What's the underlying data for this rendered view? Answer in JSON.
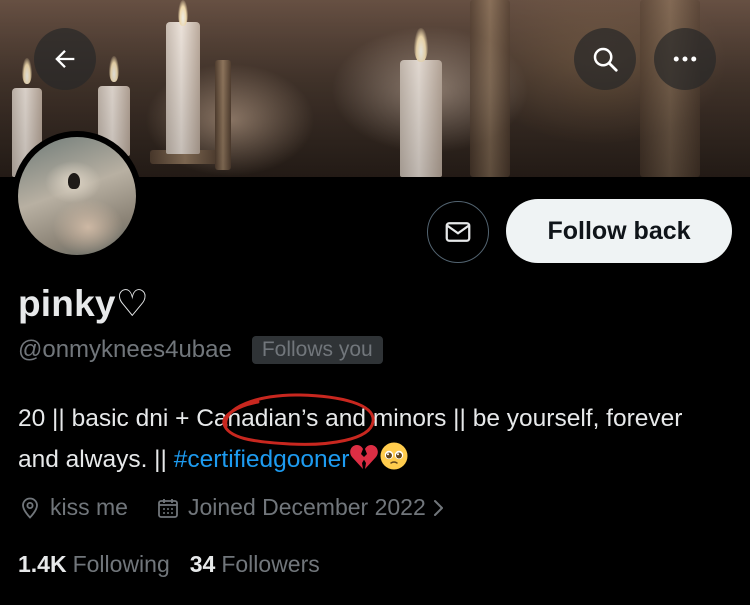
{
  "header": {
    "back_icon": "arrow-left-icon",
    "search_icon": "search-icon",
    "more_icon": "more-horizontal-icon"
  },
  "profile": {
    "display_name": "pinky♡",
    "handle": "@onmyknees4ubae",
    "follows_you_label": "Follows you",
    "bio": {
      "part1": "20 || basic dni + ",
      "highlight": "Canadian’s",
      "part2": " and minors || be yourself, forever and always. || ",
      "hashtag": "#certifiedgooner",
      "emoji_icons": [
        "broken-heart-icon",
        "pleading-face-icon"
      ]
    },
    "location": "kiss me",
    "joined": "Joined December 2022",
    "following_count": "1.4K",
    "following_label": "Following",
    "followers_count": "34",
    "followers_label": "Followers"
  },
  "actions": {
    "message_icon": "envelope-icon",
    "follow_back_label": "Follow back"
  },
  "colors": {
    "background": "#000000",
    "text_primary": "#e7e9ea",
    "text_secondary": "#71767b",
    "link": "#1d9bf0",
    "follow_button_bg": "#eff3f4",
    "annotation": "#c8271f"
  }
}
